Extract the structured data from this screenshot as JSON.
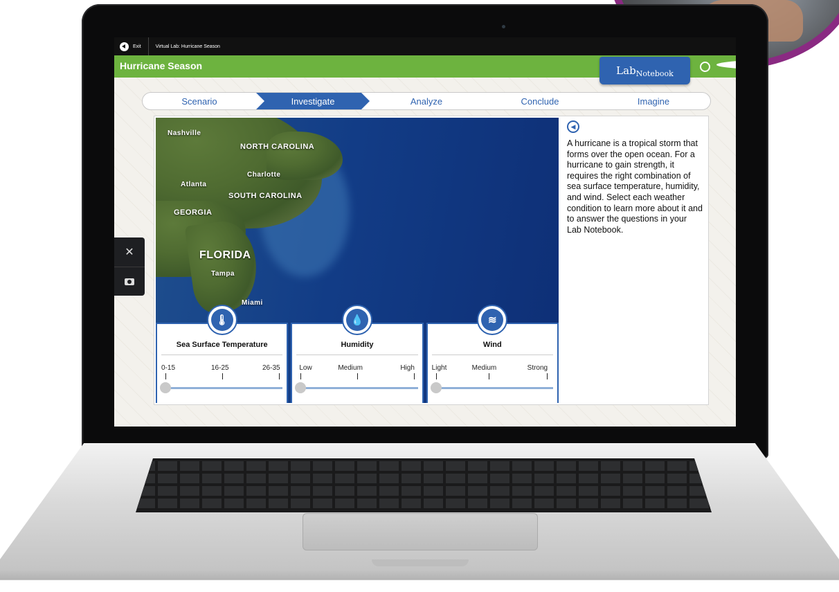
{
  "topbar": {
    "exit_label": "Exit",
    "breadcrumb": "Virtual Lab: Hurricane Season"
  },
  "header": {
    "title": "Hurricane Season",
    "notebook_main": "Lab",
    "notebook_sub": "Notebook",
    "accent": "#6db33f",
    "blue": "#2f63b0"
  },
  "steps": [
    {
      "label": "Scenario",
      "active": false
    },
    {
      "label": "Investigate",
      "active": true
    },
    {
      "label": "Analyze",
      "active": false
    },
    {
      "label": "Conclude",
      "active": false
    },
    {
      "label": "Imagine",
      "active": false
    }
  ],
  "map_labels": {
    "nashville": "Nashville",
    "north_carolina": "NORTH CAROLINA",
    "charlotte": "Charlotte",
    "atlanta": "Atlanta",
    "south_carolina": "SOUTH CAROLINA",
    "georgia": "GEORGIA",
    "florida": "FLORIDA",
    "tampa": "Tampa",
    "miami": "Miami"
  },
  "controls": [
    {
      "title": "Sea Surface Temperature",
      "icon": "thermometer-icon",
      "ticks": [
        "0-15",
        "16-25",
        "26-35"
      ]
    },
    {
      "title": "Humidity",
      "icon": "water-drop-icon",
      "ticks": [
        "Low",
        "Medium",
        "High"
      ]
    },
    {
      "title": "Wind",
      "icon": "wind-icon",
      "ticks": [
        "Light",
        "Medium",
        "Strong"
      ]
    }
  ],
  "info": {
    "text": "A hurricane is a tropical storm that forms over the open ocean. For a hurricane to gain strength, it requires the right combination of sea surface temperature, humidity, and wind. Select each weather condition to learn more about it and to answer the questions in your Lab Notebook."
  }
}
